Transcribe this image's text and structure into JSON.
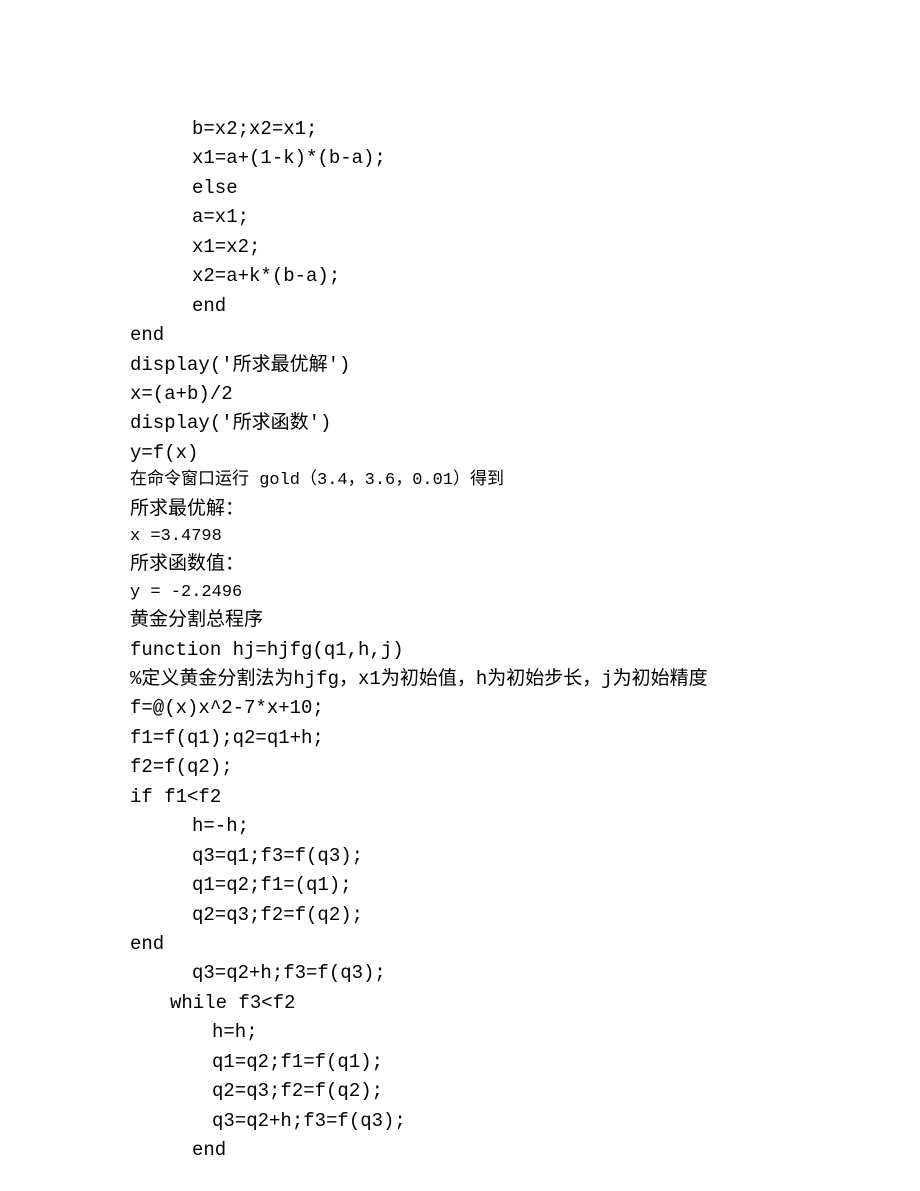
{
  "lines": [
    {
      "text": "b=x2;x2=x1;",
      "indent": "indent2"
    },
    {
      "text": "x1=a+(1-k)*(b-a);",
      "indent": "indent2"
    },
    {
      "text": "else",
      "indent": "indent2"
    },
    {
      "text": "a=x1;",
      "indent": "indent2"
    },
    {
      "text": "x1=x2;",
      "indent": "indent2"
    },
    {
      "text": "x2=a+k*(b-a);",
      "indent": "indent2"
    },
    {
      "text": "end",
      "indent": "indent2"
    },
    {
      "text": "end",
      "indent": ""
    },
    {
      "text": "display('所求最优解')",
      "indent": ""
    },
    {
      "text": "x=(a+b)/2",
      "indent": ""
    },
    {
      "text": "display('所求函数')",
      "indent": ""
    },
    {
      "text": "y=f(x)",
      "indent": ""
    },
    {
      "text": "在命令窗口运行 gold（3.4，3.6，0.01）得到",
      "indent": "",
      "small": true
    },
    {
      "text": "所求最优解：",
      "indent": ""
    },
    {
      "text": "x =3.4798",
      "indent": "",
      "small": true
    },
    {
      "text": "所求函数值：",
      "indent": ""
    },
    {
      "text": "y = -2.2496",
      "indent": "",
      "small": true
    },
    {
      "text": "黄金分割总程序",
      "indent": ""
    },
    {
      "text": "function hj=hjfg(q1,h,j)",
      "indent": ""
    },
    {
      "text": "%定义黄金分割法为hjfg，x1为初始值，h为初始步长，j为初始精度",
      "indent": ""
    },
    {
      "text": "f=@(x)x^2-7*x+10;",
      "indent": ""
    },
    {
      "text": "f1=f(q1);q2=q1+h;",
      "indent": ""
    },
    {
      "text": "f2=f(q2);",
      "indent": ""
    },
    {
      "text": "if f1<f2",
      "indent": ""
    },
    {
      "text": "h=-h;",
      "indent": "indent2"
    },
    {
      "text": "q3=q1;f3=f(q3);",
      "indent": "indent2"
    },
    {
      "text": "q1=q2;f1=(q1);",
      "indent": "indent2"
    },
    {
      "text": "q2=q3;f2=f(q2);",
      "indent": "indent2"
    },
    {
      "text": "end",
      "indent": ""
    },
    {
      "text": "q3=q2+h;f3=f(q3);",
      "indent": "indent2"
    },
    {
      "text": "while f3<f2",
      "indent": "indent1"
    },
    {
      "text": "h=h;",
      "indent": "indent3"
    },
    {
      "text": "q1=q2;f1=f(q1);",
      "indent": "indent3"
    },
    {
      "text": "q2=q3;f2=f(q2);",
      "indent": "indent3"
    },
    {
      "text": "q3=q2+h;f3=f(q3);",
      "indent": "indent3"
    },
    {
      "text": "end",
      "indent": "indent2"
    }
  ]
}
